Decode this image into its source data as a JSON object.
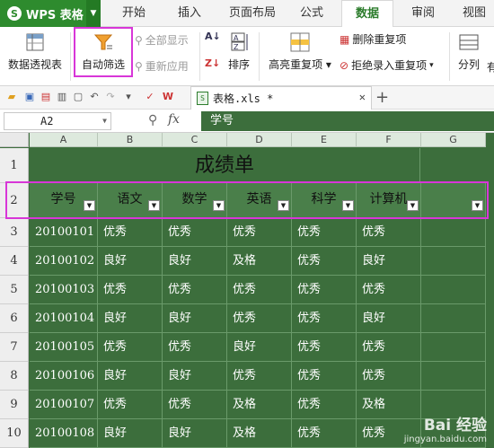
{
  "app": {
    "name": "WPS 表格",
    "logo_glyph": "S"
  },
  "tabs": [
    "开始",
    "插入",
    "页面布局",
    "公式",
    "数据",
    "审阅",
    "视图"
  ],
  "active_tab": "数据",
  "ribbon": {
    "pivot_label": "数据透视表",
    "autofilter_label": "自动筛选",
    "show_all_label": "全部显示",
    "reapply_label": "重新应用",
    "sort_label": "排序",
    "highlight_dup_label": "高亮重复项",
    "remove_dup_label": "删除重复项",
    "reject_dup_label": "拒绝录入重复项",
    "split_label": "分列",
    "more_label": "有"
  },
  "document": {
    "tab_title": "表格.xls *"
  },
  "formula_bar": {
    "name_box": "A2",
    "content": "学号"
  },
  "sheet": {
    "columns": [
      "A",
      "B",
      "C",
      "D",
      "E",
      "F",
      "G"
    ],
    "row_numbers": [
      "1",
      "2",
      "3",
      "4",
      "5",
      "6",
      "7",
      "8",
      "9",
      "10"
    ],
    "title": "成绩单",
    "headers": [
      "学号",
      "语文",
      "数学",
      "英语",
      "科学",
      "计算机",
      ""
    ],
    "rows": [
      [
        "20100101",
        "优秀",
        "优秀",
        "优秀",
        "优秀",
        "优秀"
      ],
      [
        "20100102",
        "良好",
        "良好",
        "及格",
        "优秀",
        "良好"
      ],
      [
        "20100103",
        "优秀",
        "优秀",
        "优秀",
        "优秀",
        "优秀"
      ],
      [
        "20100104",
        "良好",
        "良好",
        "优秀",
        "优秀",
        "良好"
      ],
      [
        "20100105",
        "优秀",
        "优秀",
        "良好",
        "优秀",
        "优秀"
      ],
      [
        "20100106",
        "良好",
        "良好",
        "优秀",
        "优秀",
        "优秀"
      ],
      [
        "20100107",
        "优秀",
        "优秀",
        "及格",
        "优秀",
        "及格"
      ],
      [
        "20100108",
        "良好",
        "良好",
        "及格",
        "优秀",
        "优秀"
      ]
    ]
  },
  "watermark": {
    "line1": "Bai 经验",
    "line2": "jingyan.baidu.com"
  },
  "colors": {
    "sheet_bg": "#3c6e3c",
    "brand": "#2e8b2e",
    "highlight": "#d836d8"
  }
}
